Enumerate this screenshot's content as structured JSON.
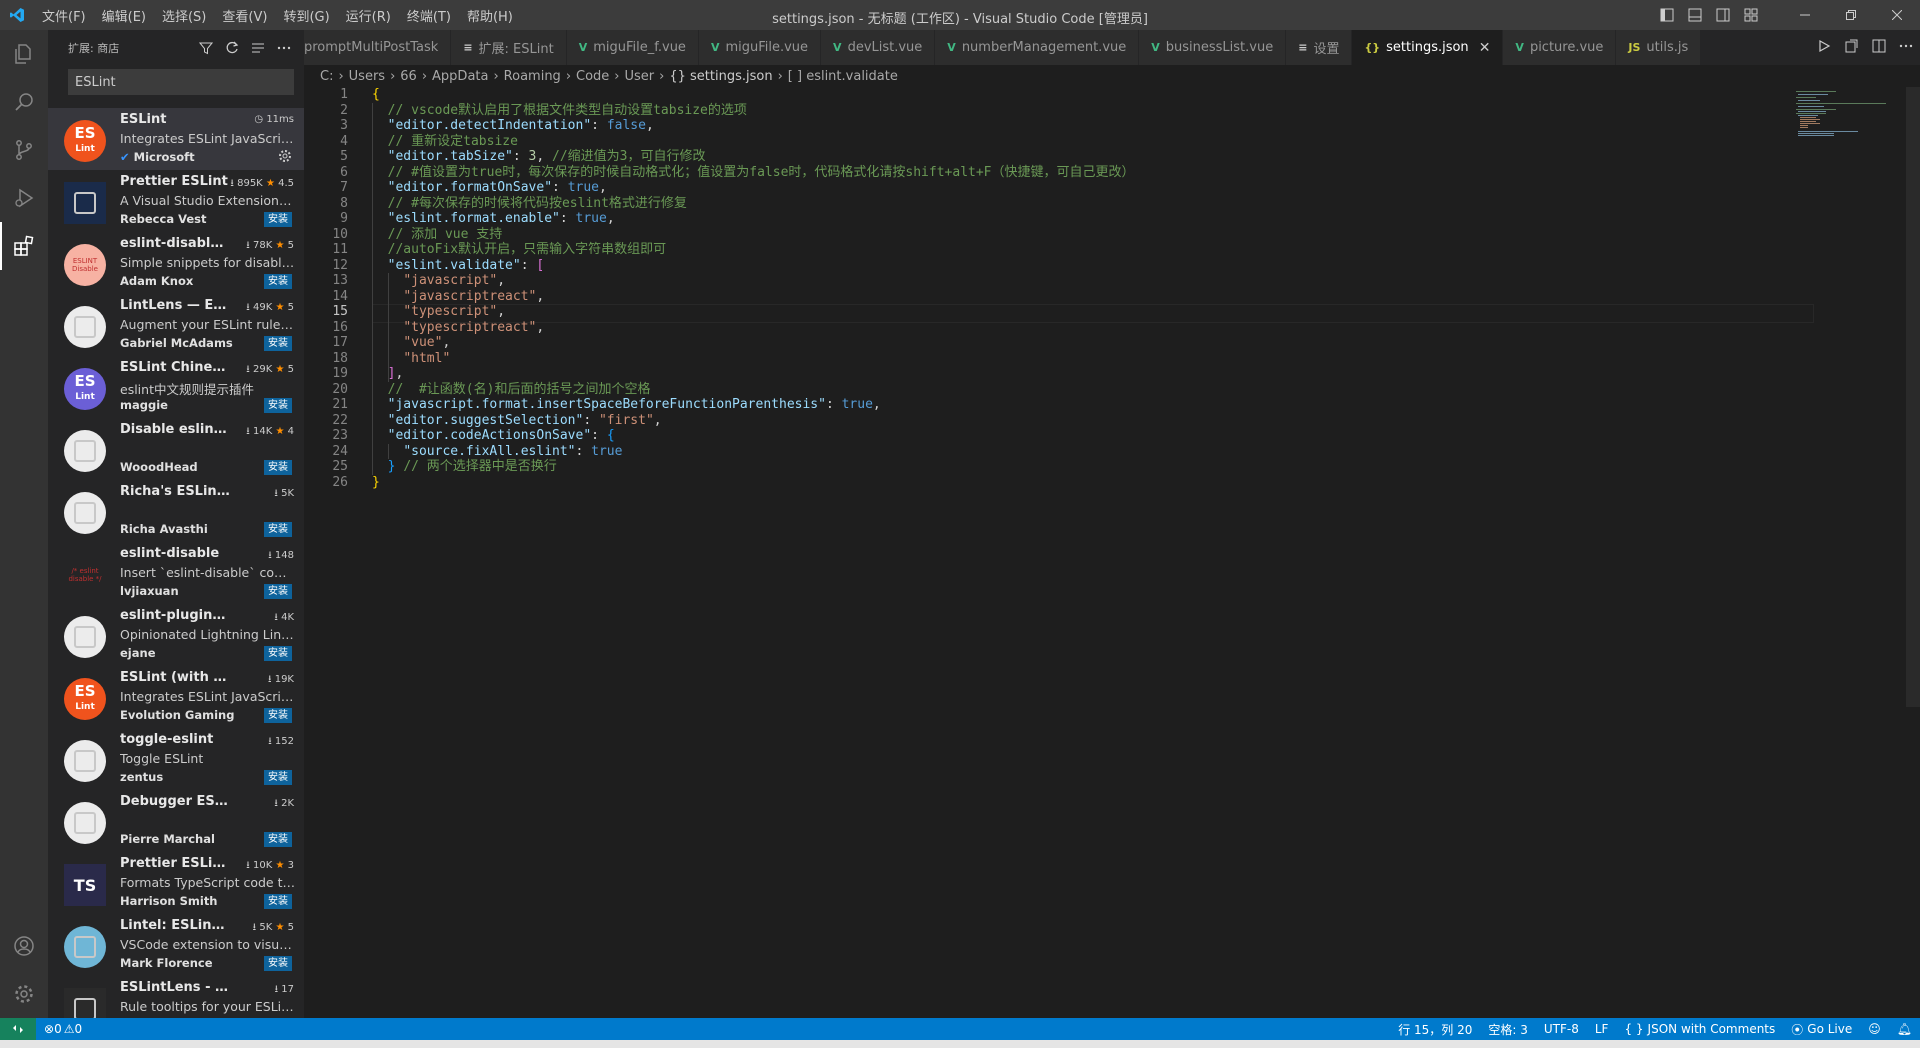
{
  "titlebar": {
    "menu": [
      "文件(F)",
      "编辑(E)",
      "选择(S)",
      "查看(V)",
      "转到(G)",
      "运行(R)",
      "终端(T)",
      "帮助(H)"
    ],
    "title": "settings.json - 无标题 (工作区) - Visual Studio Code [管理员]"
  },
  "sidebar": {
    "title": "扩展: 商店",
    "search_value": "ESLint",
    "extensions": [
      {
        "name": "ESLint",
        "stats": "11ms",
        "desc": "Integrates ESLint JavaScript i...",
        "publisher": "Microsoft",
        "install": "",
        "icon_text": "ES",
        "icon_color": "#f0531d"
      },
      {
        "name": "Prettier ESLint",
        "stats": "895K",
        "rating": "4.5",
        "desc": "A Visual Studio Extension to...",
        "publisher": "Rebecca Vest",
        "install": "安装",
        "icon_text": "",
        "icon_color": "#1a2b4a"
      },
      {
        "name": "eslint-disable-s...",
        "stats": "78K",
        "rating": "5",
        "desc": "Simple snippets for disable ...",
        "publisher": "Adam Knox",
        "install": "安装",
        "icon_text": "ESLINT Disable",
        "icon_color": "#f7b2a3"
      },
      {
        "name": "LintLens — ESLi...",
        "stats": "49K",
        "rating": "5",
        "desc": "Augment your ESLint rules i...",
        "publisher": "Gabriel McAdams",
        "install": "安装",
        "icon_text": "",
        "icon_color": "#ececec"
      },
      {
        "name": "ESLint Chinese ...",
        "stats": "29K",
        "rating": "5",
        "desc": "eslint中文规则提示插件",
        "publisher": "maggie",
        "install": "安装",
        "icon_text": "ES",
        "icon_color": "#6b5fd6"
      },
      {
        "name": "Disable eslint r...",
        "stats": "14K",
        "rating": "4",
        "desc": "",
        "publisher": "WooodHead",
        "install": "安装",
        "icon_text": "",
        "icon_color": "#ececec"
      },
      {
        "name": "Richa's ESLint Snipp...",
        "stats": "5K",
        "rating": "",
        "desc": "",
        "publisher": "Richa Avasthi",
        "install": "安装",
        "icon_text": "",
        "icon_color": "#ececec"
      },
      {
        "name": "eslint-disable",
        "stats": "148",
        "rating": "",
        "desc": "Insert `eslint-disable` comm...",
        "publisher": "lvjiaxuan",
        "install": "安装",
        "icon_text": "/* eslint disable */",
        "icon_color": "#252526"
      },
      {
        "name": "eslint-plugin-lintin...",
        "stats": "4K",
        "rating": "",
        "desc": "Opinionated Lightning Linting",
        "publisher": "ejane",
        "install": "安装",
        "icon_text": "",
        "icon_color": "#ececec"
      },
      {
        "name": "ESLint (with `autoF...",
        "stats": "19K",
        "rating": "",
        "desc": "Integrates ESLint JavaScript i...",
        "publisher": "Evolution Gaming",
        "install": "安装",
        "icon_text": "ES",
        "icon_color": "#f0531d"
      },
      {
        "name": "toggle-eslint",
        "stats": "152",
        "rating": "",
        "desc": "Toggle ESLint",
        "publisher": "zentus",
        "install": "安装",
        "icon_text": "",
        "icon_color": "#ececec"
      },
      {
        "name": "Debugger ESLint di...",
        "stats": "2K",
        "rating": "",
        "desc": "",
        "publisher": "Pierre Marchal",
        "install": "安装",
        "icon_text": "",
        "icon_color": "#ececec"
      },
      {
        "name": "Prettier ESLint ...",
        "stats": "10K",
        "rating": "3",
        "desc": "Formats TypeScript code thr...",
        "publisher": "Harrison Smith",
        "install": "安装",
        "icon_text": "TS",
        "icon_color": "#2a2a4a"
      },
      {
        "name": "Lintel: ESLint Co...",
        "stats": "5K",
        "rating": "5",
        "desc": "VSCode extension to visuali...",
        "publisher": "Mark Florence",
        "install": "安装",
        "icon_text": "",
        "icon_color": "#6fb6d6"
      },
      {
        "name": "ESLintLens - Tooltip...",
        "stats": "17",
        "rating": "",
        "desc": "Rule tooltips for your ESLint ...",
        "publisher": "",
        "install": "",
        "icon_text": "",
        "icon_color": "#2a2a2a"
      }
    ]
  },
  "tabs": [
    {
      "label": "promptMultiPostTask",
      "icon": "",
      "active": false
    },
    {
      "label": "扩展: ESLint",
      "icon": "≡",
      "active": false
    },
    {
      "label": "miguFile_f.vue",
      "icon": "V",
      "active": false
    },
    {
      "label": "miguFile.vue",
      "icon": "V",
      "active": false
    },
    {
      "label": "devList.vue",
      "icon": "V",
      "active": false
    },
    {
      "label": "numberManagement.vue",
      "icon": "V",
      "active": false
    },
    {
      "label": "businessList.vue",
      "icon": "V",
      "active": false
    },
    {
      "label": "设置",
      "icon": "≡",
      "active": false
    },
    {
      "label": "settings.json",
      "icon": "{}",
      "active": true
    },
    {
      "label": "picture.vue",
      "icon": "V",
      "active": false
    },
    {
      "label": "utils.js",
      "icon": "JS",
      "active": false
    }
  ],
  "breadcrumb": [
    "C:",
    "Users",
    "66",
    "AppData",
    "Roaming",
    "Code",
    "User",
    "{} settings.json",
    "[ ] eslint.validate"
  ],
  "editor": {
    "current_line": 15,
    "lines": [
      "{",
      "  // vscode默认启用了根据文件类型自动设置tabsize的选项",
      "  \"editor.detectIndentation\": false,",
      "  // 重新设定tabsize",
      "  \"editor.tabSize\": 3, //缩进值为3，可自行修改",
      "  // #值设置为true时，每次保存的时候自动格式化；值设置为false时，代码格式化请按shift+alt+F（快捷键，可自己更改）",
      "  \"editor.formatOnSave\": true,",
      "  // #每次保存的时候将代码按eslint格式进行修复",
      "  \"eslint.format.enable\": true,",
      "  // 添加 vue 支持",
      "  //autoFix默认开启，只需输入字符串数组即可",
      "  \"eslint.validate\": [",
      "    \"javascript\",",
      "    \"javascriptreact\",",
      "    \"typescript\",",
      "    \"typescriptreact\",",
      "    \"vue\",",
      "    \"html\"",
      "  ],",
      "  //  #让函数(名)和后面的括号之间加个空格",
      "  \"javascript.format.insertSpaceBeforeFunctionParenthesis\": true,",
      "  \"editor.suggestSelection\": \"first\",",
      "  \"editor.codeActionsOnSave\": {",
      "    \"source.fixAll.eslint\": true",
      "  } // 两个选择器中是否换行",
      "}"
    ]
  },
  "status": {
    "problems": "0",
    "warnings": "0",
    "position": "行 15，列 20",
    "spaces": "空格: 3",
    "encoding": "UTF-8",
    "eol": "LF",
    "language": "JSON with Comments",
    "golive": "Go Live"
  },
  "colors": {
    "accent": "#007acc",
    "editor_bg": "#1e1e1e",
    "sidebar_bg": "#252526"
  }
}
